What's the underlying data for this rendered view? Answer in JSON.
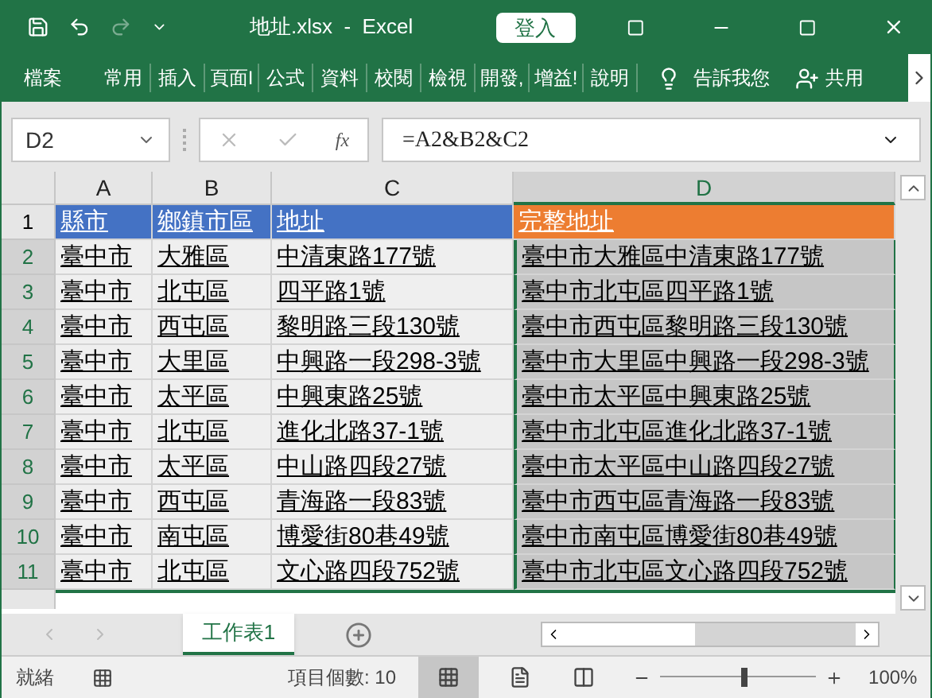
{
  "window": {
    "title": "地址.xlsx  -  Excel",
    "sign_in": "登入"
  },
  "ribbon": {
    "file_tab": "檔案",
    "tabs": [
      {
        "label": "常用",
        "selected": false
      },
      {
        "label": "插入",
        "selected": false
      },
      {
        "label": "頁面I",
        "selected": false
      },
      {
        "label": "公式",
        "selected": false
      },
      {
        "label": "資料",
        "selected": false
      },
      {
        "label": "校閱",
        "selected": false
      },
      {
        "label": "檢視",
        "selected": false
      },
      {
        "label": "開發,",
        "selected": false
      },
      {
        "label": "增益!",
        "selected": false
      },
      {
        "label": "說明",
        "selected": false
      }
    ],
    "tell_me": "告訴我您",
    "share": "共用"
  },
  "formula_bar": {
    "name_box": "D2",
    "fx": "fx",
    "formula": "=A2&B2&C2"
  },
  "columns": [
    {
      "label": "A",
      "selected": false
    },
    {
      "label": "B",
      "selected": false
    },
    {
      "label": "C",
      "selected": false
    },
    {
      "label": "D",
      "selected": true
    }
  ],
  "header_row": {
    "number": "1",
    "cells": [
      {
        "text": "縣市",
        "color": "#4472c4"
      },
      {
        "text": "鄉鎮市區",
        "color": "#4472c4"
      },
      {
        "text": "地址",
        "color": "#4472c4"
      },
      {
        "text": "完整地址",
        "color": "#ed7d31"
      }
    ]
  },
  "rows": [
    {
      "number": "2",
      "selected": true,
      "cells": [
        "臺中市",
        "大雅區",
        "中清東路177號",
        "臺中市大雅區中清東路177號"
      ]
    },
    {
      "number": "3",
      "selected": true,
      "cells": [
        "臺中市",
        "北屯區",
        "四平路1號",
        "臺中市北屯區四平路1號"
      ]
    },
    {
      "number": "4",
      "selected": true,
      "cells": [
        "臺中市",
        "西屯區",
        "黎明路三段130號",
        "臺中市西屯區黎明路三段130號"
      ]
    },
    {
      "number": "5",
      "selected": true,
      "cells": [
        "臺中市",
        "大里區",
        "中興路一段298-3號",
        "臺中市大里區中興路一段298-3號"
      ]
    },
    {
      "number": "6",
      "selected": true,
      "cells": [
        "臺中市",
        "太平區",
        "中興東路25號",
        "臺中市太平區中興東路25號"
      ]
    },
    {
      "number": "7",
      "selected": true,
      "cells": [
        "臺中市",
        "北屯區",
        "進化北路37-1號",
        "臺中市北屯區進化北路37-1號"
      ]
    },
    {
      "number": "8",
      "selected": true,
      "cells": [
        "臺中市",
        "太平區",
        "中山路四段27號",
        "臺中市太平區中山路四段27號"
      ]
    },
    {
      "number": "9",
      "selected": true,
      "cells": [
        "臺中市",
        "西屯區",
        "青海路一段83號",
        "臺中市西屯區青海路一段83號"
      ]
    },
    {
      "number": "10",
      "selected": true,
      "cells": [
        "臺中市",
        "南屯區",
        "博愛街80巷49號",
        "臺中市南屯區博愛街80巷49號"
      ]
    },
    {
      "number": "11",
      "selected": true,
      "cells": [
        "臺中市",
        "北屯區",
        "文心路四段752號",
        "臺中市北屯區文心路四段752號"
      ]
    }
  ],
  "sheet_tabs": [
    {
      "label": "工作表1",
      "selected": true
    }
  ],
  "status_bar": {
    "mode": "就緒",
    "count": "項目個數: 10",
    "zoom": "100%",
    "zoom_level": {
      "level": 0.5
    }
  }
}
